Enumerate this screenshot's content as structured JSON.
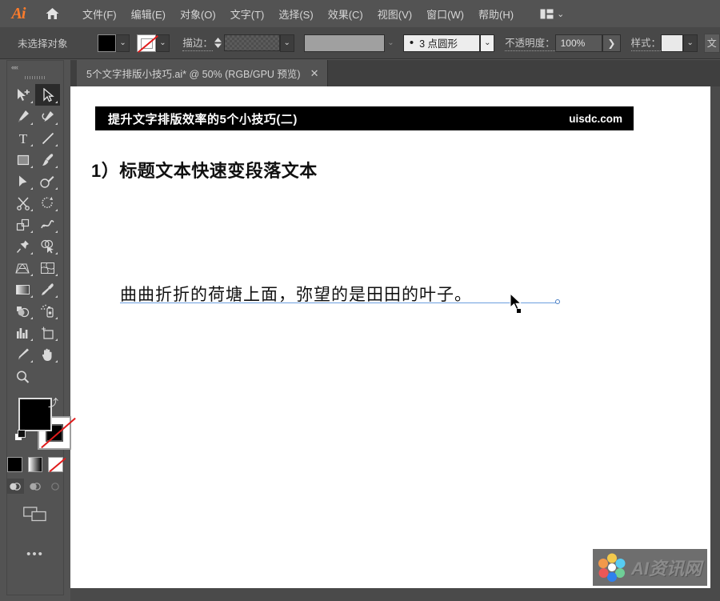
{
  "app": {
    "name": "Adobe Illustrator",
    "logo_text": "Ai",
    "home_icon": "home-icon",
    "arrange_icon": "arrange-documents-icon",
    "arrange_caret": "⌄"
  },
  "menubar": {
    "items": [
      {
        "label": "文件(F)",
        "name": "menu-file"
      },
      {
        "label": "编辑(E)",
        "name": "menu-edit"
      },
      {
        "label": "对象(O)",
        "name": "menu-object"
      },
      {
        "label": "文字(T)",
        "name": "menu-type"
      },
      {
        "label": "选择(S)",
        "name": "menu-select"
      },
      {
        "label": "效果(C)",
        "name": "menu-effect"
      },
      {
        "label": "视图(V)",
        "name": "menu-view"
      },
      {
        "label": "窗口(W)",
        "name": "menu-window"
      },
      {
        "label": "帮助(H)",
        "name": "menu-help"
      }
    ]
  },
  "controlbar": {
    "selection_status": "未选择对象",
    "fill_label": "fill-swatch",
    "fill_color": "#000000",
    "stroke_label": "stroke-swatch",
    "stroke_color": "none",
    "stroke_text": "描边：",
    "stroke_weight_value": "",
    "stroke_profile_value": "",
    "brush_definition": "3 点圆形",
    "brush_bullet": "•",
    "opacity_label": "不透明度：",
    "opacity_value": "100%",
    "opacity_arrow": "❯",
    "style_label": "样式：",
    "style_swatch": "style-swatch",
    "caret_glyph": "⌄",
    "overflow_label": "文"
  },
  "tabbar": {
    "document_title": "5个文字排版小技巧.ai* @ 50% (RGB/GPU 预览)",
    "close_glyph": "✕"
  },
  "toolbar": {
    "collapse_glyph": "««",
    "tools": [
      {
        "name": "tool-selection-plus",
        "label": "选择工具",
        "active": false,
        "icon": "cursor-plus-icon"
      },
      {
        "name": "tool-direct-selection",
        "label": "直接选择工具",
        "active": true,
        "icon": "direct-select-arrow-icon"
      },
      {
        "name": "tool-pen",
        "label": "钢笔工具",
        "active": false,
        "icon": "pen-icon"
      },
      {
        "name": "tool-curvature",
        "label": "曲率工具",
        "active": false,
        "icon": "curvature-icon"
      },
      {
        "name": "tool-type",
        "label": "文字工具",
        "active": false,
        "icon": "type-T-icon"
      },
      {
        "name": "tool-line-segment",
        "label": "直线段工具",
        "active": false,
        "icon": "line-segment-icon"
      },
      {
        "name": "tool-rectangle",
        "label": "矩形工具",
        "active": false,
        "icon": "rectangle-icon"
      },
      {
        "name": "tool-paintbrush",
        "label": "画笔工具",
        "active": false,
        "icon": "paintbrush-icon"
      },
      {
        "name": "tool-shaper",
        "label": "Shaper 工具",
        "active": false,
        "icon": "shaper-arrow-icon"
      },
      {
        "name": "tool-blob-brush",
        "label": "斑点画笔工具",
        "active": false,
        "icon": "blob-brush-icon"
      },
      {
        "name": "tool-scissors",
        "label": "剪刀工具",
        "active": false,
        "icon": "scissors-icon"
      },
      {
        "name": "tool-rotate",
        "label": "旋转工具",
        "active": false,
        "icon": "rotate-icon"
      },
      {
        "name": "tool-scale",
        "label": "比例缩放工具",
        "active": false,
        "icon": "scale-icon"
      },
      {
        "name": "tool-width",
        "label": "宽度工具",
        "active": false,
        "icon": "warp-icon"
      },
      {
        "name": "tool-free-transform",
        "label": "自由变换工具",
        "active": false,
        "icon": "pushpin-icon"
      },
      {
        "name": "tool-shape-builder",
        "label": "形状生成器工具",
        "active": false,
        "icon": "shape-builder-icon"
      },
      {
        "name": "tool-perspective-grid",
        "label": "透视网格工具",
        "active": false,
        "icon": "perspective-grid-icon"
      },
      {
        "name": "tool-mesh",
        "label": "网格工具",
        "active": false,
        "icon": "mesh-icon"
      },
      {
        "name": "tool-gradient",
        "label": "渐变工具",
        "active": false,
        "icon": "gradient-icon"
      },
      {
        "name": "tool-eyedropper",
        "label": "吸管工具",
        "active": false,
        "icon": "eyedropper-icon"
      },
      {
        "name": "tool-blend",
        "label": "混合工具",
        "active": false,
        "icon": "blend-icon"
      },
      {
        "name": "tool-symbol-sprayer",
        "label": "符号喷枪工具",
        "active": false,
        "icon": "symbol-sprayer-icon"
      },
      {
        "name": "tool-column-graph",
        "label": "柱形图工具",
        "active": false,
        "icon": "bar-chart-icon"
      },
      {
        "name": "tool-artboard",
        "label": "画板工具",
        "active": false,
        "icon": "artboard-icon"
      },
      {
        "name": "tool-slice",
        "label": "切片工具",
        "active": false,
        "icon": "slice-knife-icon"
      },
      {
        "name": "tool-hand",
        "label": "抓手工具",
        "active": false,
        "icon": "hand-icon"
      },
      {
        "name": "tool-zoom",
        "label": "缩放工具",
        "active": false,
        "icon": "magnifier-icon"
      }
    ],
    "fill_color": "#000000",
    "stroke_color": "none",
    "swap_glyph": "⤴",
    "modes": [
      {
        "name": "mode-color",
        "label": "颜色"
      },
      {
        "name": "mode-gradient",
        "label": "渐变"
      },
      {
        "name": "mode-none",
        "label": "无"
      }
    ],
    "draw_modes": [
      {
        "name": "draw-normal",
        "label": "正常绘图",
        "selected": true
      },
      {
        "name": "draw-behind",
        "label": "背面绘图",
        "selected": false
      },
      {
        "name": "draw-inside",
        "label": "内部绘图",
        "selected": false
      }
    ],
    "screen_mode": "screen-mode-icon",
    "overflow_glyph": "•••"
  },
  "canvas": {
    "banner_title": "提升文字排版效率的5个小技巧(二)",
    "banner_site": "uisdc.com",
    "headline": "1）标题文本快速变段落文本",
    "body_text": "曲曲折折的荷塘上面，弥望的是田田的叶子。",
    "selection_color": "#6c9ede",
    "cursor_icon": "arrow-pointer-cursor",
    "watermark_text": "AI资讯网",
    "watermark_logo": "flower-logo-icon"
  }
}
